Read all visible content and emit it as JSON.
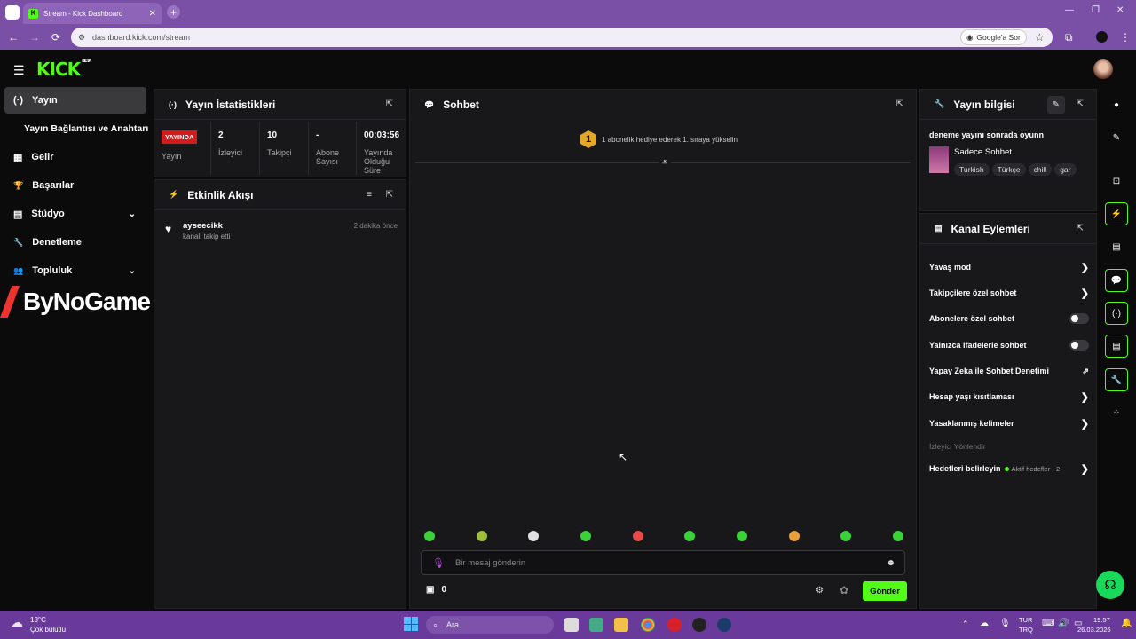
{
  "browser": {
    "tab_title": "Stream - Kick Dashboard",
    "tab_favicon": "K",
    "new_tab": "+",
    "url": "dashboard.kick.com/stream",
    "google_ask": "Google'a Sor",
    "controls": {
      "back": "←",
      "forward": "→",
      "reload": "⟳",
      "star": "☆",
      "menu": "⋮",
      "minimize": "—",
      "restore": "❐",
      "close": "✕",
      "tab_close": "✕"
    }
  },
  "kick": {
    "logo": "KICK",
    "logo_beta": "BETA",
    "accent": "#53fc18"
  },
  "sidebar": {
    "items": [
      {
        "label": "Yayın",
        "icon": "(·)",
        "active": true
      },
      {
        "label": "Yayın Bağlantısı ve Anahtarı",
        "icon": ""
      },
      {
        "label": "Gelir",
        "icon": "▦"
      },
      {
        "label": "Başarılar",
        "icon": "🏆"
      },
      {
        "label": "Stüdyo",
        "icon": "▤",
        "chevron": "⌄"
      },
      {
        "label": "Denetleme",
        "icon": "🔧"
      },
      {
        "label": "Topluluk",
        "icon": "👥",
        "chevron": "⌄"
      }
    ],
    "watermark": "ByNoGame"
  },
  "stats_panel": {
    "title": "Yayın İstatistikleri",
    "icon": "(·)",
    "live_badge": "YAYINDA",
    "live_label": "Yayın",
    "stats": [
      {
        "value": "2",
        "label": "İzleyici"
      },
      {
        "value": "10",
        "label": "Takipçi"
      },
      {
        "value": "-",
        "label": "Abone Sayısı"
      },
      {
        "value": "00:03:56",
        "label": "Yayında Olduğu Süre"
      }
    ]
  },
  "activity_panel": {
    "title": "Etkinlik Akışı",
    "icon": "⚡",
    "events": [
      {
        "user": "ayseecikk",
        "action": "kanalı takip etti",
        "time": "2 dakika önce",
        "icon": "♥"
      }
    ]
  },
  "chat_panel": {
    "title": "Sohbet",
    "icon": "💬",
    "notice": "1 abonelik hediye ederek 1. sıraya yükselin",
    "rank": "1",
    "input_placeholder": "Bir mesaj gönderin",
    "points": "0",
    "send_label": "Gönder"
  },
  "stream_info_panel": {
    "title": "Yayın bilgisi",
    "stream_title": "deneme yayını sonrada oyunn",
    "category": "Sadece Sohbet",
    "tags": [
      "Turkish",
      "Türkçe",
      "chill",
      "gar"
    ]
  },
  "channel_actions_panel": {
    "title": "Kanal Eylemleri",
    "actions": [
      {
        "label": "Yavaş mod",
        "control": "chevron"
      },
      {
        "label": "Takipçilere özel sohbet",
        "control": "chevron"
      },
      {
        "label": "Abonelere özel sohbet",
        "control": "toggle"
      },
      {
        "label": "Yalnızca ifadelerle sohbet",
        "control": "toggle"
      },
      {
        "label": "Yapay Zeka ile Sohbet Denetimi",
        "control": "external"
      },
      {
        "label": "Hesap yaşı kısıtlaması",
        "control": "chevron"
      },
      {
        "label": "Yasaklanmış kelimeler",
        "control": "chevron"
      }
    ],
    "section": "İzleyici Yönlendir",
    "goals_label": "Hedefleri belirleyin",
    "goals_status": "Aktif hedefler - 2"
  },
  "taskbar": {
    "weather_temp": "13°C",
    "weather_desc": "Çok bulutlu",
    "search": "Ara",
    "lang_top": "TUR",
    "lang_bottom": "TRQ",
    "time": "19:57",
    "date": "26.03.2026"
  }
}
